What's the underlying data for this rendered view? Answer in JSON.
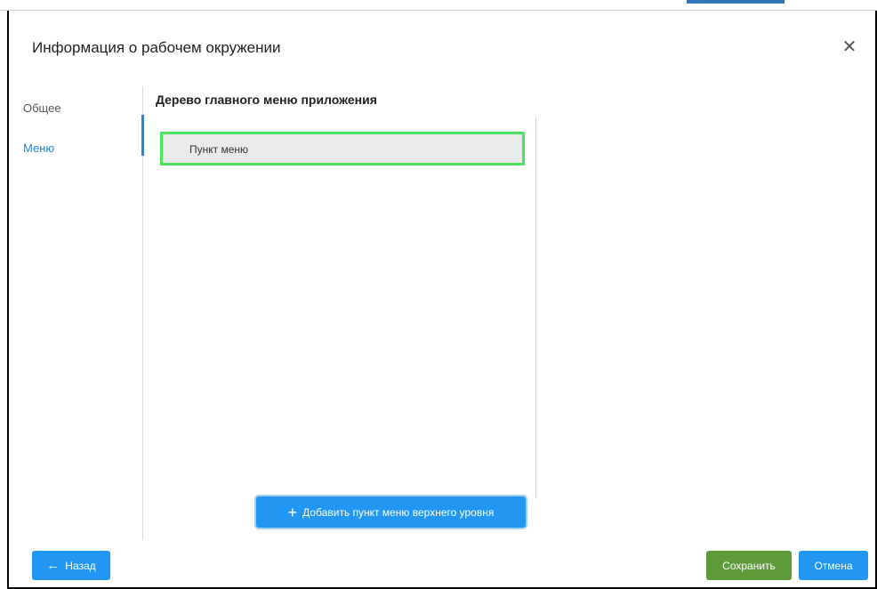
{
  "dialog": {
    "title": "Информация о рабочем окружении",
    "close_icon": "close-icon",
    "close_glyph": "✕"
  },
  "nav": {
    "items": [
      {
        "label": "Общее",
        "active": false
      },
      {
        "label": "Меню",
        "active": true
      }
    ]
  },
  "content": {
    "section_title": "Дерево главного меню приложения",
    "tree_items": [
      {
        "label": "Пункт меню",
        "selected": true
      }
    ],
    "add_button": {
      "icon": "plus-icon",
      "glyph": "+",
      "label": "Добавить пункт меню верхнего уровня"
    }
  },
  "footer": {
    "back_button": {
      "icon": "arrow-left-icon",
      "glyph": "←",
      "label": "Назад"
    },
    "save_button": {
      "label": "Сохранить"
    },
    "cancel_button": {
      "label": "Отмена"
    }
  },
  "colors": {
    "accent": "#2196f3",
    "save": "#5c9a3a",
    "selection_outline": "#4ce35c",
    "active_nav": "#1e88e5"
  }
}
